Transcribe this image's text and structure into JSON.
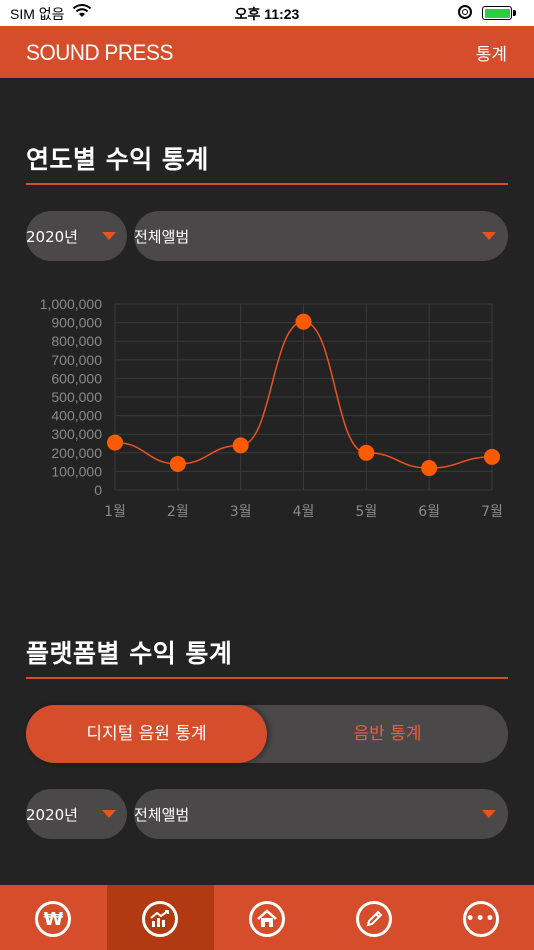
{
  "status_bar": {
    "carrier": "SIM 없음",
    "time": "오후 11:23"
  },
  "header": {
    "logo": "SOUND PRESS",
    "action_label": "통계"
  },
  "yearly": {
    "title": "연도별 수익 통계",
    "year_select": "2020년",
    "album_select": "전체앨범"
  },
  "chart_data": {
    "type": "line",
    "categories": [
      "1월",
      "2월",
      "3월",
      "4월",
      "5월",
      "6월",
      "7월"
    ],
    "values": [
      255000,
      140000,
      240000,
      905000,
      200000,
      118000,
      178000
    ],
    "ylim": [
      0,
      1000000
    ],
    "yticks": [
      "0",
      "100,000",
      "200,000",
      "300,000",
      "400,000",
      "500,000",
      "600,000",
      "700,000",
      "800,000",
      "900,000",
      "1,000,000"
    ],
    "grid": true,
    "line_color": "#e85420",
    "point_color": "#ff5a00"
  },
  "platform": {
    "title": "플랫폼별 수익 통계",
    "tab_digital": "디지털 음원 통계",
    "tab_album": "음반 통계",
    "year_select": "2020년",
    "album_select": "전체앨범"
  },
  "nav": {
    "items": [
      {
        "icon": "won-icon",
        "glyph": "₩"
      },
      {
        "icon": "stats-chart-icon",
        "glyph": ""
      },
      {
        "icon": "home-icon",
        "glyph": ""
      },
      {
        "icon": "edit-pencil-icon",
        "glyph": ""
      },
      {
        "icon": "more-icon",
        "glyph": "•••"
      }
    ]
  },
  "colors": {
    "accent": "#d64d2b",
    "background": "#242323",
    "control": "#4a4848"
  }
}
